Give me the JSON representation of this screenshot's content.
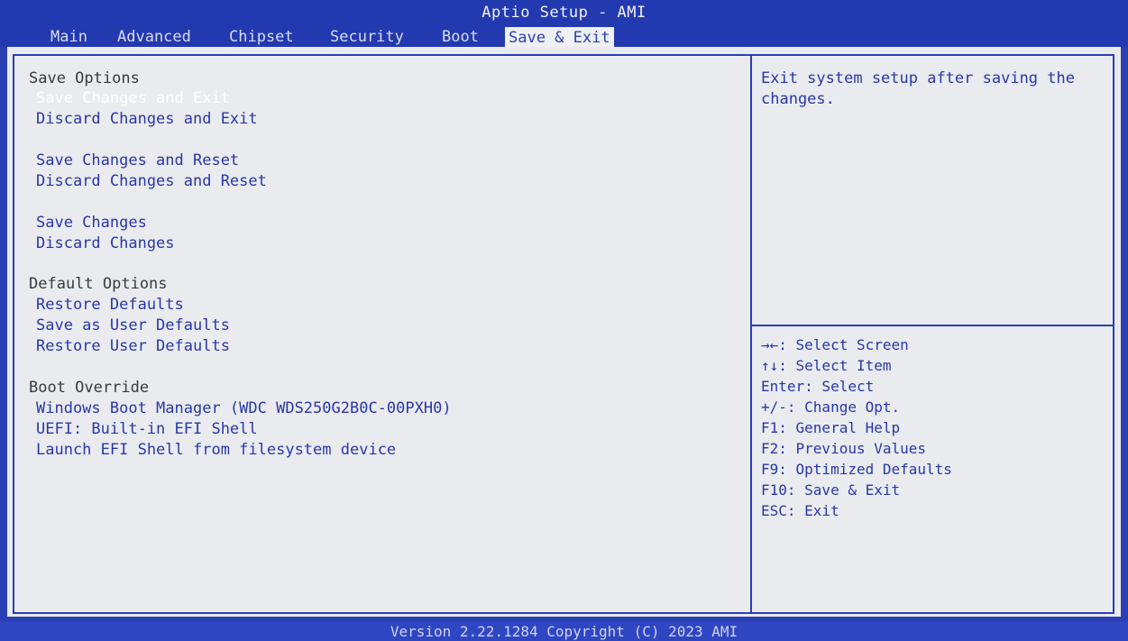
{
  "header": {
    "title": "Aptio Setup - AMI",
    "tabs": [
      {
        "label": "Main",
        "active": false
      },
      {
        "label": "Advanced",
        "active": false
      },
      {
        "label": "Chipset",
        "active": false
      },
      {
        "label": "Security",
        "active": false
      },
      {
        "label": "Boot",
        "active": false
      },
      {
        "label": "Save & Exit",
        "active": true
      }
    ]
  },
  "menu": {
    "save_options_header": "Save Options",
    "save_changes_and_exit": "Save Changes and Exit",
    "discard_changes_and_exit": "Discard Changes and Exit",
    "save_changes_and_reset": "Save Changes and Reset",
    "discard_changes_and_reset": "Discard Changes and Reset",
    "save_changes": "Save Changes",
    "discard_changes": "Discard Changes",
    "default_options_header": "Default Options",
    "restore_defaults": "Restore Defaults",
    "save_as_user_defaults": "Save as User Defaults",
    "restore_user_defaults": "Restore User Defaults",
    "boot_override_header": "Boot Override",
    "windows_boot_manager": "Windows Boot Manager (WDC WDS250G2B0C-00PXH0)",
    "uefi_builtin_shell": "UEFI: Built-in EFI Shell",
    "launch_efi_shell": "Launch EFI Shell from filesystem device",
    "selected_item": "Save Changes and Exit"
  },
  "help": {
    "description": "Exit system setup after saving the changes."
  },
  "keys": [
    "→←: Select Screen",
    "↑↓: Select Item",
    "Enter: Select",
    "+/-: Change Opt.",
    "F1: General Help",
    "F2: Previous Values",
    "F9: Optimized Defaults",
    "F10: Save & Exit",
    "ESC: Exit"
  ],
  "footer": {
    "text": "Version 2.22.1284 Copyright (C) 2023 AMI"
  },
  "colors": {
    "background_blue": "#2b3fb4",
    "panel_gray": "#e9ebee",
    "item_blue": "#2a37a8",
    "selected_white": "#ffffff"
  }
}
